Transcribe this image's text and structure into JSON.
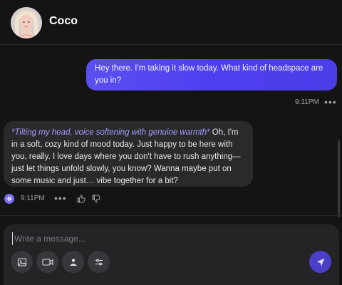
{
  "header": {
    "title": "Coco"
  },
  "messages": {
    "user": {
      "text": "Hey there. I'm taking it slow today. What kind of headspace are you in?",
      "time": "9:11PM"
    },
    "bot": {
      "italic": "*Tilting my head, voice softening with genuine warmth*",
      "text": " Oh, I'm in a soft, cozy kind of mood today. Just happy to be here with you, really. I love days where you don't have to rush anything—just let things unfold slowly, you know? Wanna maybe put on some music and just… vibe together for a bit?",
      "time": "9:11PM"
    }
  },
  "composer": {
    "placeholder": "Write a message..."
  },
  "icons": {
    "voice": "voice-play-icon",
    "more": "more-dots-icon",
    "like": "thumbs-up-icon",
    "dislike": "thumbs-down-icon",
    "image": "image-icon",
    "video": "video-icon",
    "scene": "scene-icon",
    "settings": "sliders-icon",
    "send": "send-icon"
  },
  "colors": {
    "accent": "#4f3ef0",
    "italic": "#a49cff",
    "background": "#141414",
    "bot_bubble": "#2a2a2c"
  }
}
